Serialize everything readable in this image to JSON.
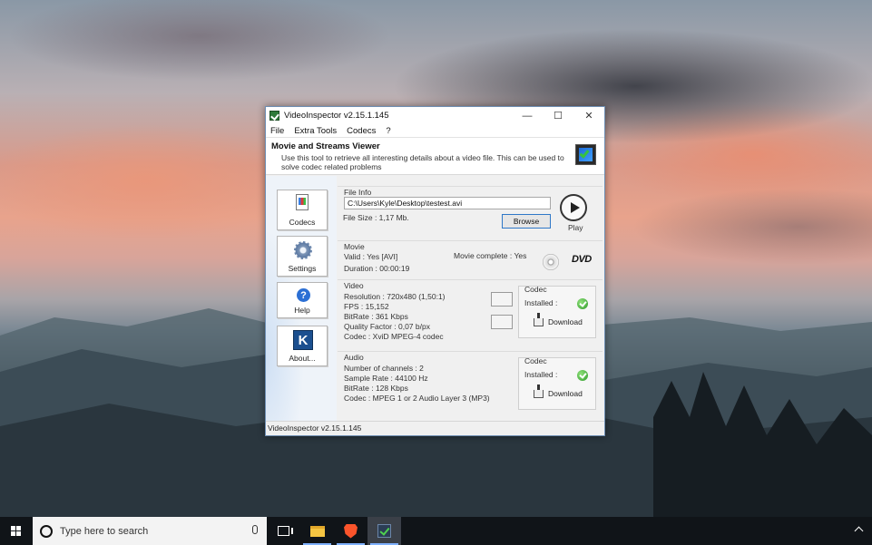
{
  "window": {
    "title": "VideoInspector v2.15.1.145",
    "controls": {
      "minimize": "—",
      "maximize": "☐",
      "close": "✕"
    }
  },
  "menu": [
    "File",
    "Extra Tools",
    "Codecs",
    "?"
  ],
  "header": {
    "title": "Movie and Streams Viewer",
    "description": "Use this tool to retrieve all interesting details about a video file. This can be used to solve codec related problems"
  },
  "sidebar": {
    "codecs": "Codecs",
    "settings": "Settings",
    "help": "Help",
    "about": "About..."
  },
  "file_info": {
    "group_title": "File Info",
    "path": "C:\\Users\\Kyle\\Desktop\\testest.avi",
    "file_size": "File Size : 1,17 Mb.",
    "browse_label": "Browse",
    "play_label": "Play"
  },
  "movie": {
    "group_title": "Movie",
    "valid": "Valid : Yes [AVI]",
    "duration": "Duration : 00:00:19",
    "complete": "Movie complete : Yes",
    "dvd_label": "DVD"
  },
  "video": {
    "group_title": "Video",
    "resolution": "Resolution : 720x480 (1,50:1)",
    "fps": "FPS : 15,152",
    "bitrate": "BitRate : 361 Kbps",
    "quality": "Quality Factor : 0,07 b/px",
    "codec": "Codec : XviD MPEG-4 codec",
    "codec_box": {
      "title": "Codec",
      "installed": "Installed :",
      "download": "Download"
    }
  },
  "audio": {
    "group_title": "Audio",
    "channels": "Number of channels : 2",
    "sample_rate": "Sample Rate : 44100 Hz",
    "bitrate": "BitRate : 128 Kbps",
    "codec": "Codec : MPEG 1 or 2 Audio Layer 3 (MP3)",
    "codec_box": {
      "title": "Codec",
      "installed": "Installed :",
      "download": "Download"
    }
  },
  "statusbar": "VideoInspector v2.15.1.145",
  "taskbar": {
    "search_placeholder": "Type here to search",
    "help_glyph": "?",
    "about_glyph": "K"
  }
}
